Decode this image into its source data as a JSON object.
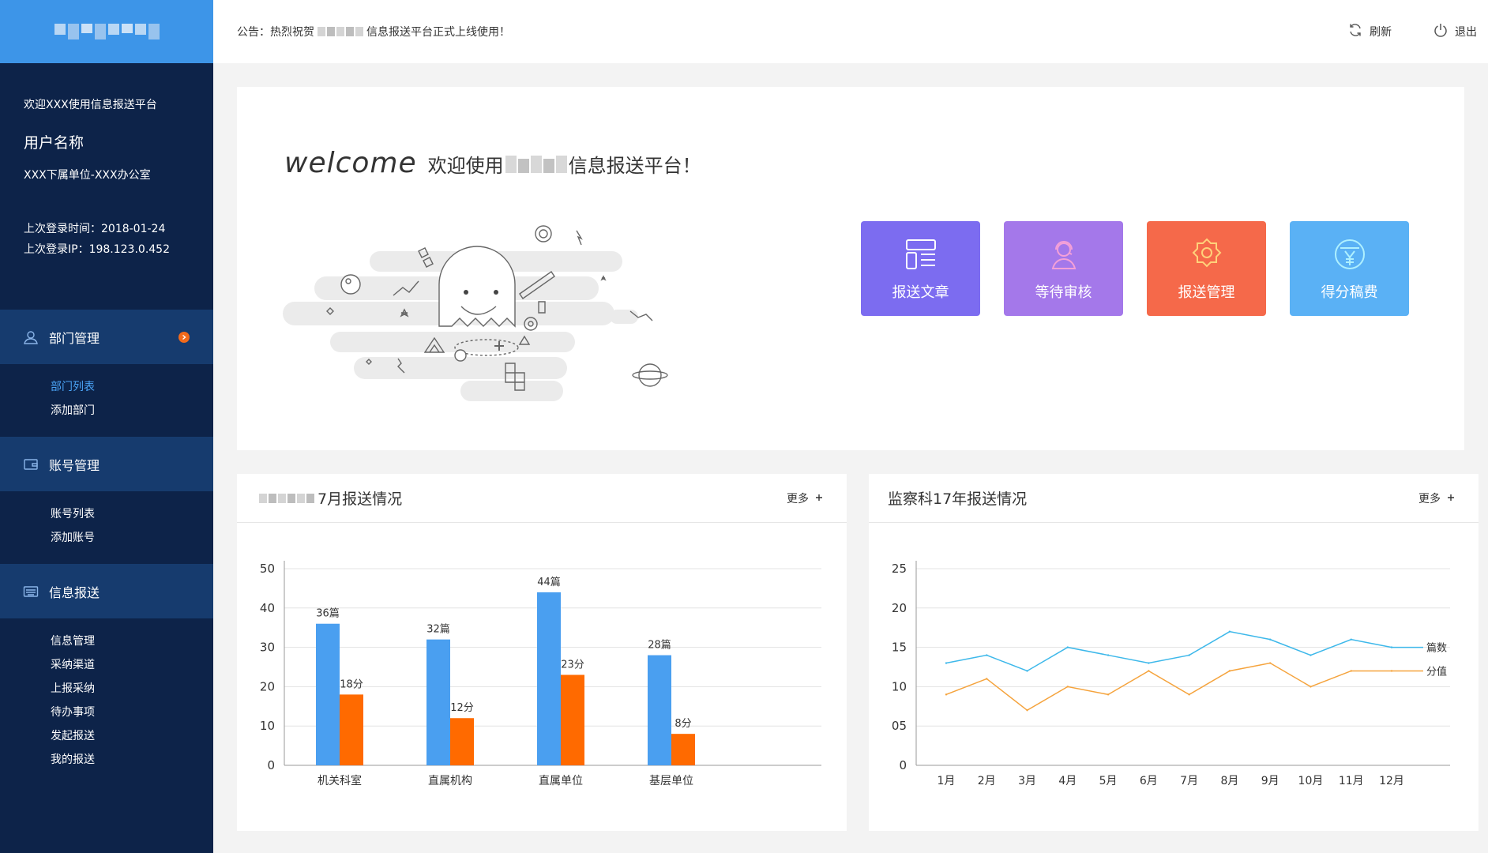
{
  "sidebar": {
    "welcome": "欢迎XXX使用信息报送平台",
    "user_name": "用户名称",
    "user_dept": "XXX下属单位-XXX办公室",
    "last_login_time": "上次登录时间：2018-01-24",
    "last_login_ip": "上次登录IP：198.123.0.452",
    "groups": [
      {
        "label": "部门管理",
        "icon": "user-icon",
        "items": [
          "部门列表",
          "添加部门"
        ]
      },
      {
        "label": "账号管理",
        "icon": "wallet-icon",
        "items": [
          "账号列表",
          "添加账号"
        ]
      },
      {
        "label": "信息报送",
        "icon": "keyboard-icon",
        "items": [
          "信息管理",
          "采纳渠道",
          "上报采纳",
          "待办事项",
          "发起报送",
          "我的报送"
        ]
      }
    ]
  },
  "topbar": {
    "notice_prefix": "公告：热烈祝贺",
    "notice_suffix": "信息报送平台正式上线使用！",
    "refresh": "刷新",
    "logout": "退出"
  },
  "welcome": {
    "en": "welcome",
    "cn_prefix": "欢迎使用",
    "cn_suffix": "信息报送平台！"
  },
  "tiles": [
    {
      "label": "报送文章",
      "color": "#7c6cf0",
      "icon": "article-icon"
    },
    {
      "label": "等待审核",
      "color": "#a478ea",
      "icon": "headset-icon"
    },
    {
      "label": "报送管理",
      "color": "#f5694a",
      "icon": "gear-icon"
    },
    {
      "label": "得分稿费",
      "color": "#5ab1f5",
      "icon": "yen-icon"
    }
  ],
  "left_chart_card": {
    "title_suffix": "7月报送情况",
    "more": "更多"
  },
  "right_chart_card": {
    "title": "监察科17年报送情况",
    "more": "更多"
  },
  "chart_data": [
    {
      "type": "bar",
      "categories": [
        "机关科室",
        "直属机构",
        "直属单位",
        "基层单位"
      ],
      "series": [
        {
          "values": [
            36,
            32,
            44,
            28
          ],
          "labels": [
            "36篇",
            "32篇",
            "44篇",
            "28篇"
          ],
          "color": "#4a9ff0"
        },
        {
          "values": [
            18,
            12,
            23,
            8
          ],
          "labels": [
            "18分",
            "12分",
            "23分",
            "8分"
          ],
          "color": "#ff6a00"
        }
      ],
      "ylim": [
        0,
        50
      ],
      "yticks": [
        "0",
        "10",
        "20",
        "30",
        "40",
        "50"
      ],
      "grid": true
    },
    {
      "type": "line",
      "categories": [
        "1月",
        "2月",
        "3月",
        "4月",
        "5月",
        "6月",
        "7月",
        "8月",
        "9月",
        "10月",
        "11月",
        "12月"
      ],
      "series": [
        {
          "name": "篇数",
          "values": [
            13,
            14,
            12,
            15,
            14,
            13,
            14,
            17,
            16,
            14,
            16,
            15
          ],
          "color": "#3db8ea"
        },
        {
          "name": "分值",
          "values": [
            9,
            11,
            7,
            10,
            9,
            12,
            9,
            12,
            13,
            10,
            12,
            12
          ],
          "color": "#f5a33c"
        }
      ],
      "ylim": [
        0,
        25
      ],
      "yticks": [
        "0",
        "05",
        "10",
        "15",
        "20",
        "25"
      ],
      "grid": true
    }
  ]
}
